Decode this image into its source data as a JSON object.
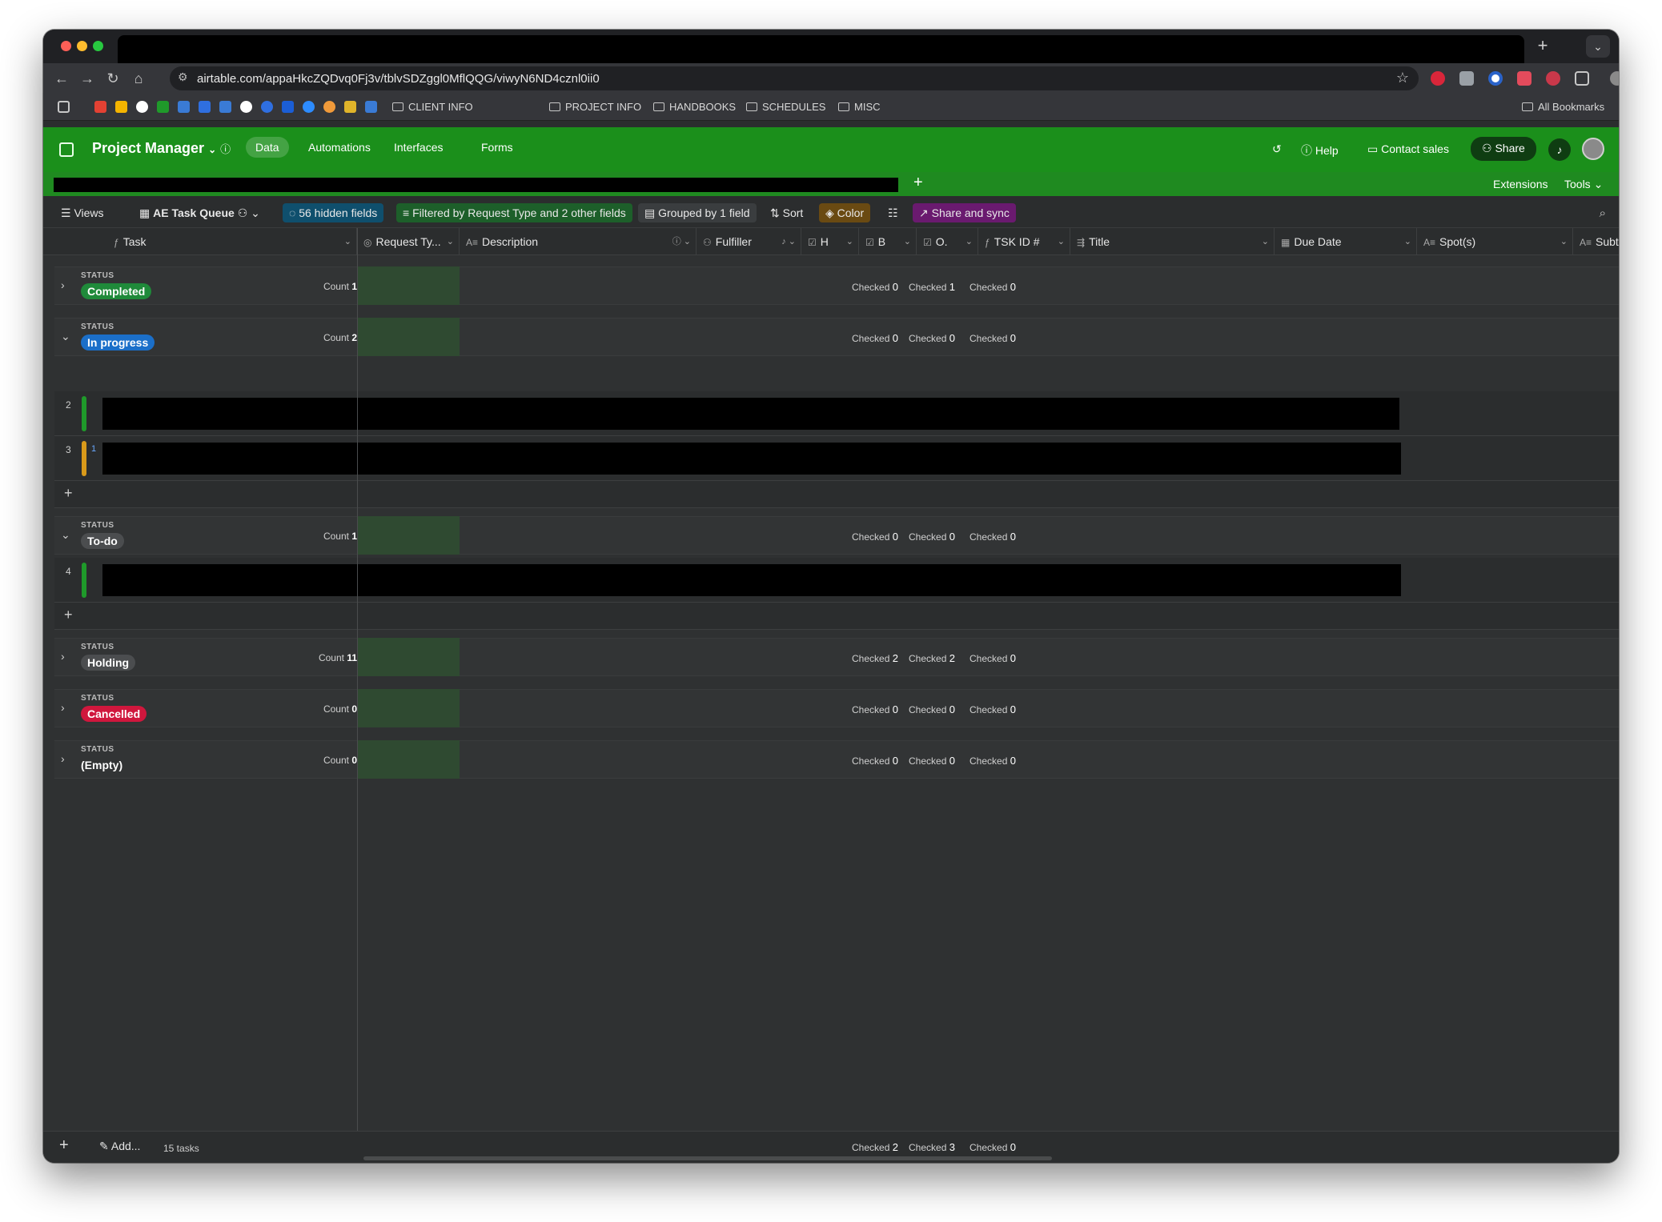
{
  "browser": {
    "url": "airtable.com/appaHkcZQDvq0Fj3v/tblvSDZggl0MflQQG/viwyN6ND4cznl0ii0",
    "bookmark_folders": [
      "CLIENT INFO",
      "PROJECT INFO",
      "HANDBOOKS",
      "SCHEDULES",
      "MISC"
    ],
    "all_bookmarks": "All Bookmarks"
  },
  "header": {
    "base_name": "Project Manager",
    "tabs": [
      "Data",
      "Automations",
      "Interfaces",
      "Forms"
    ],
    "help": "Help",
    "contact_sales": "Contact sales",
    "share": "Share"
  },
  "tablebar": {
    "extensions": "Extensions",
    "tools": "Tools"
  },
  "viewbar": {
    "views": "Views",
    "view_name": "AE Task Queue",
    "hidden_fields": "56 hidden fields",
    "filter": "Filtered by Request Type and 2 other fields",
    "group": "Grouped by 1 field",
    "sort": "Sort",
    "color": "Color",
    "share_sync": "Share and sync"
  },
  "columns": [
    "Task",
    "Request Ty...",
    "Description",
    "Fulfiller",
    "H",
    "B",
    "O.",
    "TSK ID #",
    "Title",
    "Due Date",
    "Spot(s)",
    "Subt"
  ],
  "group_label": "STATUS",
  "count_label": "Count",
  "checked_label": "Checked",
  "groups": [
    {
      "name": "Completed",
      "count": "1",
      "checked": [
        "0",
        "1",
        "0"
      ]
    },
    {
      "name": "In progress",
      "count": "2",
      "checked": [
        "0",
        "0",
        "0"
      ]
    },
    {
      "name": "To-do",
      "count": "1",
      "checked": [
        "0",
        "0",
        "0"
      ]
    },
    {
      "name": "Holding",
      "count": "11",
      "checked": [
        "2",
        "2",
        "0"
      ]
    },
    {
      "name": "Cancelled",
      "count": "0",
      "checked": [
        "0",
        "0",
        "0"
      ]
    },
    {
      "name": "(Empty)",
      "count": "0",
      "checked": [
        "0",
        "0",
        "0"
      ]
    }
  ],
  "rows": [
    {
      "num": "2",
      "color": "#1f9a2a"
    },
    {
      "num": "3",
      "color": "#d99a1a",
      "badge": "1"
    },
    {
      "num": "4",
      "color": "#1f9a2a"
    }
  ],
  "footer": {
    "add": "Add...",
    "tasks": "15 tasks",
    "checked": [
      "2",
      "3",
      "0"
    ]
  }
}
